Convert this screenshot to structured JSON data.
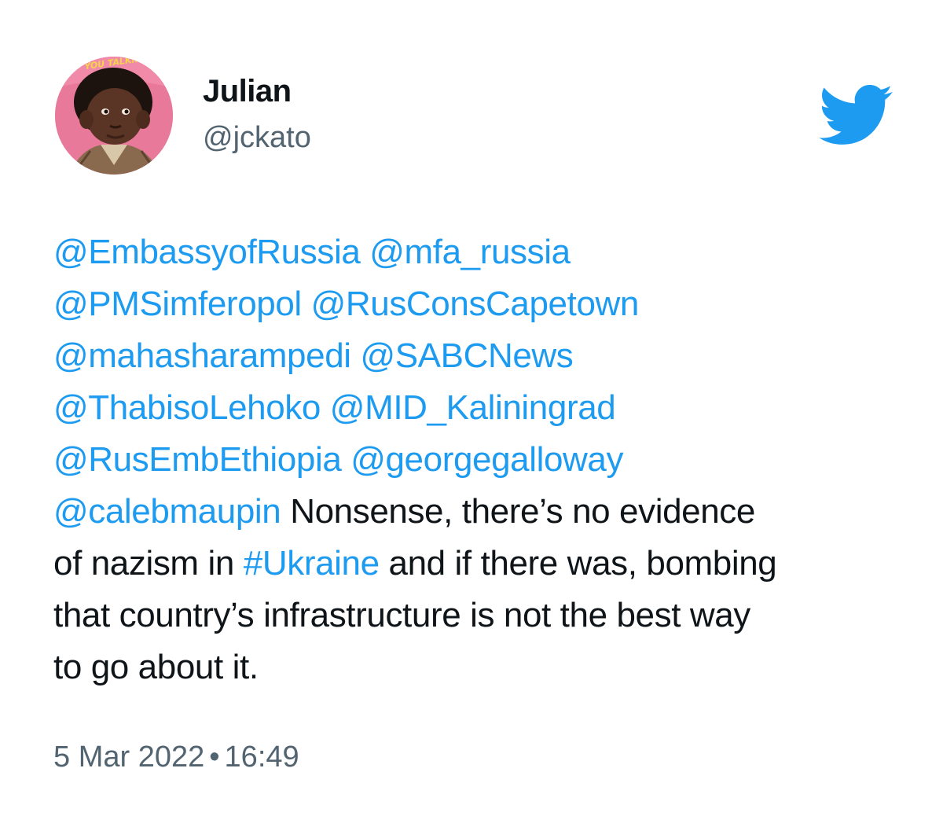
{
  "user": {
    "display_name": "Julian",
    "handle": "@jckato",
    "avatar_text": "YOU TALKIN"
  },
  "brand": {
    "icon": "twitter-bird-icon",
    "color": "#1d9bf0"
  },
  "tweet": {
    "lines": [
      [
        {
          "type": "mention",
          "text": "@EmbassyofRussia"
        },
        {
          "type": "text",
          "text": " "
        },
        {
          "type": "mention",
          "text": "@mfa_russia"
        }
      ],
      [
        {
          "type": "mention",
          "text": "@PMSimferopol"
        },
        {
          "type": "text",
          "text": " "
        },
        {
          "type": "mention",
          "text": "@RusConsCapetown"
        }
      ],
      [
        {
          "type": "mention",
          "text": "@mahasharampedi"
        },
        {
          "type": "text",
          "text": " "
        },
        {
          "type": "mention",
          "text": "@SABCNews"
        }
      ],
      [
        {
          "type": "mention",
          "text": "@ThabisoLehoko"
        },
        {
          "type": "text",
          "text": " "
        },
        {
          "type": "mention",
          "text": "@MID_Kaliningrad"
        }
      ],
      [
        {
          "type": "mention",
          "text": "@RusEmbEthiopia"
        },
        {
          "type": "text",
          "text": " "
        },
        {
          "type": "mention",
          "text": "@georgegalloway"
        }
      ],
      [
        {
          "type": "mention",
          "text": "@calebmaupin"
        },
        {
          "type": "text",
          "text": " Nonsense, there’s no evidence"
        }
      ],
      [
        {
          "type": "text",
          "text": "of nazism in "
        },
        {
          "type": "hashtag",
          "text": "#Ukraine"
        },
        {
          "type": "text",
          "text": " and if there was, bombing"
        }
      ],
      [
        {
          "type": "text",
          "text": "that country’s infrastructure is not the best way"
        }
      ],
      [
        {
          "type": "text",
          "text": "to go about it."
        }
      ]
    ],
    "date": "5 Mar 2022",
    "separator": "•",
    "time": "16:49"
  },
  "colors": {
    "mention": "#1d9bf0",
    "text": "#0f1419",
    "secondary": "#536471"
  }
}
